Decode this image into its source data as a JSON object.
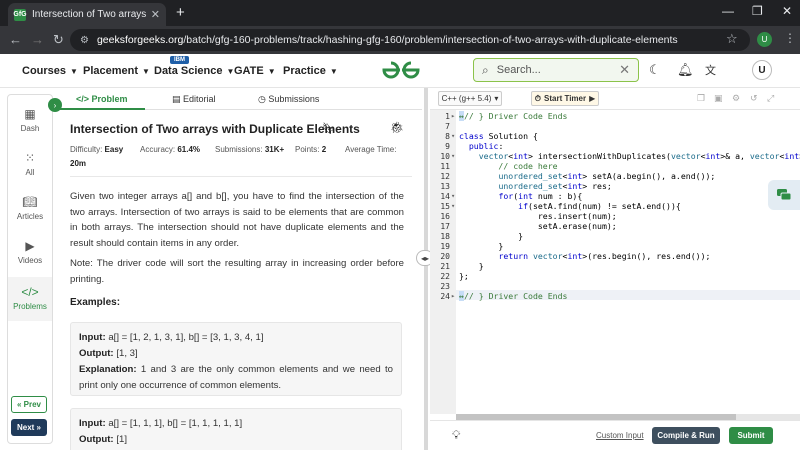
{
  "browser": {
    "tab_title": "Intersection of Two arrays with",
    "favicon_text": "GfG",
    "url_host": "geeksforgeeks.org",
    "url_path": "/batch/gfg-160-problems/track/hashing-gfg-160/problem/intersection-of-two-arrays-with-duplicate-elements",
    "profile_initial": "U"
  },
  "header": {
    "nav": [
      "Courses",
      "Placement",
      "Data Science",
      "GATE",
      "Practice"
    ],
    "ibm_badge": "IBM",
    "search_placeholder": "Search...",
    "user_initial": "U"
  },
  "sidebar": {
    "items": [
      "Dash",
      "All",
      "Articles",
      "Videos",
      "Problems"
    ],
    "prev": "« Prev",
    "next": "Next »"
  },
  "problem": {
    "tabs": [
      "Problem",
      "Editorial",
      "Submissions"
    ],
    "title": "Intersection of Two arrays with Duplicate Elements",
    "meta": {
      "difficulty_label": "Difficulty:",
      "difficulty": "Easy",
      "accuracy_label": "Accuracy:",
      "accuracy": "61.4%",
      "submissions_label": "Submissions:",
      "submissions": "31K+",
      "points_label": "Points:",
      "points": "2",
      "time_label": "Average Time:",
      "time": "20m"
    },
    "desc_1": "Given two integer arrays a[] and b[], you have to find the intersection of the two arrays. Intersection of two arrays is said to be elements that are common in both arrays. The intersection should not have duplicate elements and the result should contain items in any order.",
    "desc_2": "Note: The driver code will sort the resulting array in increasing order before printing.",
    "examples_heading": "Examples:",
    "example1": {
      "input_label": "Input:",
      "input": "a[] = [1, 2, 1, 3, 1], b[] = [3, 1, 3, 4, 1]",
      "output_label": "Output:",
      "output": "[1, 3]",
      "explanation_label": "Explanation:",
      "explanation": "1 and 3 are the only common elements and we need to print only one occurrence of common elements."
    },
    "example2": {
      "input_label": "Input:",
      "input": "a[] = [1, 1, 1], b[] = [1, 1, 1, 1, 1]",
      "output_label": "Output:",
      "output": "[1]"
    }
  },
  "editor": {
    "language": "C++ (g++ 5.4)",
    "start_timer": "Start Timer",
    "custom_input": "Custom Input",
    "compile_run": "Compile & Run",
    "submit": "Submit",
    "line_numbers": [
      "1",
      "7",
      "8",
      "9",
      "10",
      "11",
      "12",
      "13",
      "14",
      "15",
      "16",
      "17",
      "18",
      "19",
      "20",
      "21",
      "22",
      "23",
      "24"
    ]
  }
}
